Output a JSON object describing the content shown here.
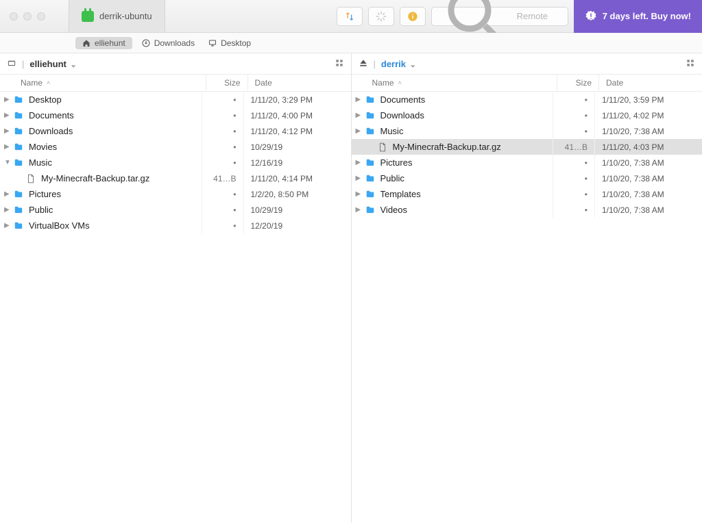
{
  "titlebar": {
    "tab_label": "derrik-ubuntu",
    "search_placeholder": "Remote",
    "buy_banner": "7 days left. Buy now!"
  },
  "favorites": {
    "home": "elliehunt",
    "downloads": "Downloads",
    "desktop": "Desktop"
  },
  "columns": {
    "name": "Name",
    "size": "Size",
    "date": "Date"
  },
  "left": {
    "user": "elliehunt",
    "rows": [
      {
        "type": "folder",
        "name": "Desktop",
        "size": "•",
        "date": "1/11/20, 3:29 PM",
        "indent": 0
      },
      {
        "type": "folder",
        "name": "Documents",
        "size": "•",
        "date": "1/11/20, 4:00 PM",
        "indent": 0
      },
      {
        "type": "folder",
        "name": "Downloads",
        "size": "•",
        "date": "1/11/20, 4:12 PM",
        "indent": 0
      },
      {
        "type": "folder",
        "name": "Movies",
        "size": "•",
        "date": "10/29/19",
        "indent": 0
      },
      {
        "type": "folder-open",
        "name": "Music",
        "size": "•",
        "date": "12/16/19",
        "indent": 0,
        "expanded": true
      },
      {
        "type": "file",
        "name": "My-Minecraft-Backup.tar.gz",
        "size": "41…B",
        "date": "1/11/20, 4:14 PM",
        "indent": 1
      },
      {
        "type": "folder",
        "name": "Pictures",
        "size": "•",
        "date": "1/2/20, 8:50 PM",
        "indent": 0
      },
      {
        "type": "folder",
        "name": "Public",
        "size": "•",
        "date": "10/29/19",
        "indent": 0
      },
      {
        "type": "folder",
        "name": "VirtualBox VMs",
        "size": "•",
        "date": "12/20/19",
        "indent": 0
      }
    ]
  },
  "right": {
    "user": "derrik",
    "rows": [
      {
        "type": "folder",
        "name": "Documents",
        "size": "•",
        "date": "1/11/20, 3:59 PM",
        "indent": 0
      },
      {
        "type": "folder",
        "name": "Downloads",
        "size": "•",
        "date": "1/11/20, 4:02 PM",
        "indent": 0
      },
      {
        "type": "folder",
        "name": "Music",
        "size": "•",
        "date": "1/10/20, 7:38 AM",
        "indent": 0
      },
      {
        "type": "file",
        "name": "My-Minecraft-Backup.tar.gz",
        "size": "41…B",
        "date": "1/11/20, 4:03 PM",
        "indent": 1,
        "selected": true
      },
      {
        "type": "folder",
        "name": "Pictures",
        "size": "•",
        "date": "1/10/20, 7:38 AM",
        "indent": 0
      },
      {
        "type": "folder",
        "name": "Public",
        "size": "•",
        "date": "1/10/20, 7:38 AM",
        "indent": 0
      },
      {
        "type": "folder",
        "name": "Templates",
        "size": "•",
        "date": "1/10/20, 7:38 AM",
        "indent": 0
      },
      {
        "type": "folder",
        "name": "Videos",
        "size": "•",
        "date": "1/10/20, 7:38 AM",
        "indent": 0
      }
    ]
  }
}
